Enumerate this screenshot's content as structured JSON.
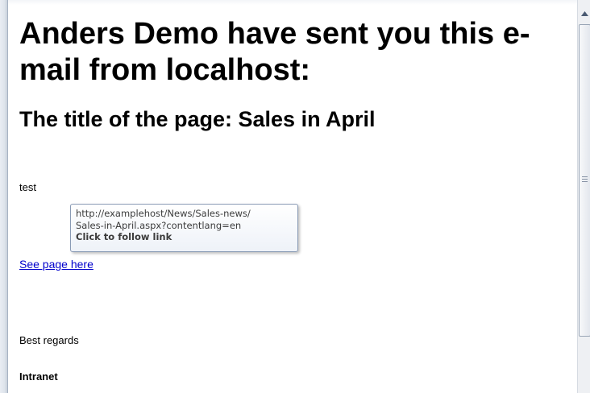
{
  "email": {
    "heading": "Anders Demo have sent you this e-mail from localhost:",
    "page_title": "The title of the page: Sales in April",
    "message": "test",
    "link_text": "See page here",
    "regards": "Best regards",
    "signature": "Intranet"
  },
  "tooltip": {
    "line1": "http://examplehost/News/Sales-news/",
    "line2": "Sales-in-April.aspx?contentlang=en",
    "action": "Click to follow link"
  },
  "icons": {
    "scroll_up": "scroll-up-arrow",
    "scroll_grip": "scroll-thumb-grip"
  },
  "colors": {
    "link": "#0000cc",
    "tooltip_border": "#8a9bb5"
  }
}
